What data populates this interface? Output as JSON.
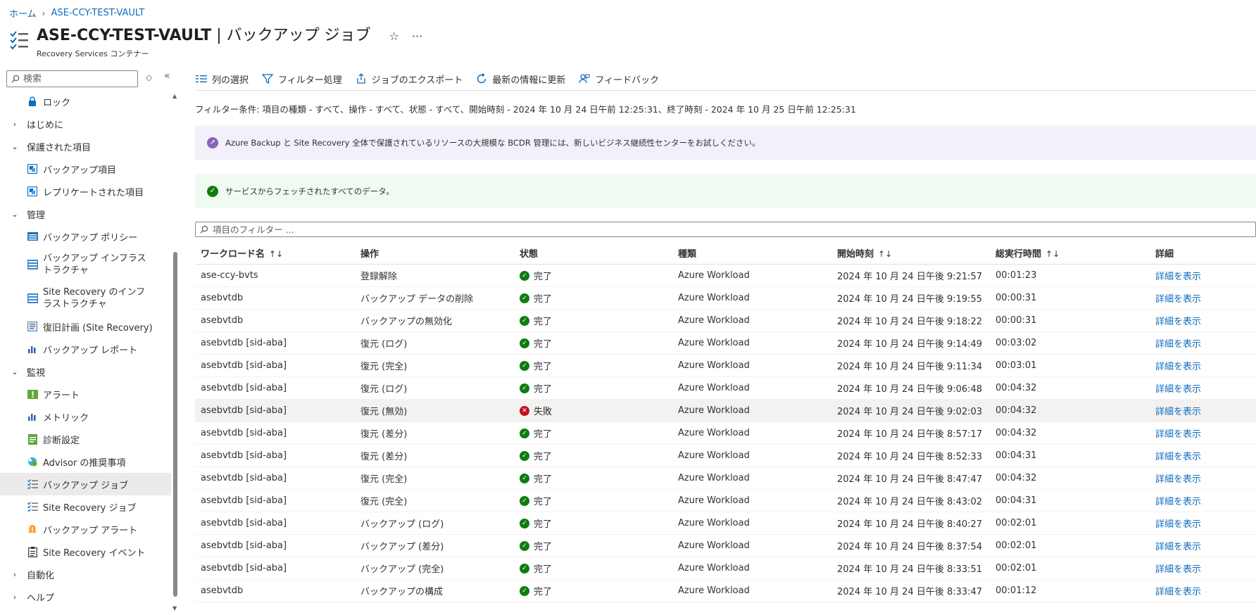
{
  "breadcrumb": {
    "home": "ホーム",
    "vault": "ASE-CCY-TEST-VAULT"
  },
  "header": {
    "title_main": "ASE-CCY-TEST-VAULT",
    "title_sep": " | ",
    "title_page": "バックアップ ジョブ",
    "subtitle": "Recovery Services コンテナー",
    "star_icon": "☆",
    "more_icon": "···"
  },
  "sidebar": {
    "search_placeholder": "検索",
    "items": [
      {
        "type": "child",
        "label": "ロック",
        "icon": "lock-icon"
      },
      {
        "type": "group",
        "label": "はじめに",
        "chev": "›"
      },
      {
        "type": "group",
        "label": "保護された項目",
        "chev": "⌄"
      },
      {
        "type": "child",
        "label": "バックアップ項目",
        "icon": "backup-items-icon"
      },
      {
        "type": "child",
        "label": "レプリケートされた項目",
        "icon": "replicated-items-icon"
      },
      {
        "type": "group",
        "label": "管理",
        "chev": "⌄"
      },
      {
        "type": "child",
        "label": "バックアップ ポリシー",
        "icon": "policy-icon"
      },
      {
        "type": "child",
        "label": "バックアップ インフラストラクチャ",
        "icon": "infrastructure-icon"
      },
      {
        "type": "child",
        "label": "Site Recovery のインフラストラクチャ",
        "icon": "site-recovery-infra-icon"
      },
      {
        "type": "child",
        "label": "復旧計画 (Site Recovery)",
        "icon": "recovery-plan-icon"
      },
      {
        "type": "child",
        "label": "バックアップ レポート",
        "icon": "reports-icon"
      },
      {
        "type": "group",
        "label": "監視",
        "chev": "⌄"
      },
      {
        "type": "child",
        "label": "アラート",
        "icon": "alert-icon"
      },
      {
        "type": "child",
        "label": "メトリック",
        "icon": "metrics-icon"
      },
      {
        "type": "child",
        "label": "診断設定",
        "icon": "diagnostic-icon"
      },
      {
        "type": "child",
        "label": "Advisor の推奨事項",
        "icon": "advisor-icon"
      },
      {
        "type": "child",
        "label": "バックアップ ジョブ",
        "icon": "jobs-icon"
      },
      {
        "type": "child",
        "label": "Site Recovery ジョブ",
        "icon": "site-recovery-jobs-icon"
      },
      {
        "type": "child",
        "label": "バックアップ アラート",
        "icon": "backup-alert-icon"
      },
      {
        "type": "child",
        "label": "Site Recovery イベント",
        "icon": "events-icon"
      },
      {
        "type": "group",
        "label": "自動化",
        "chev": "›"
      },
      {
        "type": "group",
        "label": "ヘルプ",
        "chev": "›"
      }
    ]
  },
  "toolbar": {
    "columns": "列の選択",
    "filter": "フィルター処理",
    "export": "ジョブのエクスポート",
    "refresh": "最新の情報に更新",
    "feedback": "フィードバック"
  },
  "filter_conditions": "フィルター条件: 項目の種類 - すべて、操作 - すべて、状態 - すべて、開始時刻 - 2024 年 10 月 24 日午前 12:25:31、終了時刻 - 2024 年 10 月 25 日午前 12:25:31",
  "banners": {
    "info": "Azure Backup と Site Recovery 全体で保護されているリソースの大規模な BCDR 管理には、新しいビジネス継続性センターをお試しください。",
    "success": "サービスからフェッチされたすべてのデータ。"
  },
  "grid_filter_placeholder": "項目のフィルター ...",
  "table": {
    "headers": {
      "workload": "ワークロード名",
      "operation": "操作",
      "status": "状態",
      "type": "種類",
      "start": "開始時刻",
      "duration": "総実行時間",
      "details": "詳細"
    },
    "sort_glyph": "↑↓",
    "rows": [
      {
        "workload": "ase-ccy-bvts",
        "operation": "登録解除",
        "status": "完了",
        "type": "Azure Workload",
        "start": "2024 年 10 月 24 日午後 9:21:57",
        "duration": "00:01:23",
        "details": "詳細を表示"
      },
      {
        "workload": "asebvtdb",
        "operation": "バックアップ データの削除",
        "status": "完了",
        "type": "Azure Workload",
        "start": "2024 年 10 月 24 日午後 9:19:55",
        "duration": "00:00:31",
        "details": "詳細を表示"
      },
      {
        "workload": "asebvtdb",
        "operation": "バックアップの無効化",
        "status": "完了",
        "type": "Azure Workload",
        "start": "2024 年 10 月 24 日午後 9:18:22",
        "duration": "00:00:31",
        "details": "詳細を表示"
      },
      {
        "workload": "asebvtdb [sid-aba]",
        "operation": "復元 (ログ)",
        "status": "完了",
        "type": "Azure Workload",
        "start": "2024 年 10 月 24 日午後 9:14:49",
        "duration": "00:03:02",
        "details": "詳細を表示"
      },
      {
        "workload": "asebvtdb [sid-aba]",
        "operation": "復元 (完全)",
        "status": "完了",
        "type": "Azure Workload",
        "start": "2024 年 10 月 24 日午後 9:11:34",
        "duration": "00:03:01",
        "details": "詳細を表示"
      },
      {
        "workload": "asebvtdb [sid-aba]",
        "operation": "復元 (ログ)",
        "status": "完了",
        "type": "Azure Workload",
        "start": "2024 年 10 月 24 日午後 9:06:48",
        "duration": "00:04:32",
        "details": "詳細を表示"
      },
      {
        "workload": "asebvtdb [sid-aba]",
        "operation": "復元 (無効)",
        "status": "失敗",
        "type": "Azure Workload",
        "start": "2024 年 10 月 24 日午後 9:02:03",
        "duration": "00:04:32",
        "details": "詳細を表示"
      },
      {
        "workload": "asebvtdb [sid-aba]",
        "operation": "復元 (差分)",
        "status": "完了",
        "type": "Azure Workload",
        "start": "2024 年 10 月 24 日午後 8:57:17",
        "duration": "00:04:32",
        "details": "詳細を表示"
      },
      {
        "workload": "asebvtdb [sid-aba]",
        "operation": "復元 (差分)",
        "status": "完了",
        "type": "Azure Workload",
        "start": "2024 年 10 月 24 日午後 8:52:33",
        "duration": "00:04:31",
        "details": "詳細を表示"
      },
      {
        "workload": "asebvtdb [sid-aba]",
        "operation": "復元 (完全)",
        "status": "完了",
        "type": "Azure Workload",
        "start": "2024 年 10 月 24 日午後 8:47:47",
        "duration": "00:04:32",
        "details": "詳細を表示"
      },
      {
        "workload": "asebvtdb [sid-aba]",
        "operation": "復元 (完全)",
        "status": "完了",
        "type": "Azure Workload",
        "start": "2024 年 10 月 24 日午後 8:43:02",
        "duration": "00:04:31",
        "details": "詳細を表示"
      },
      {
        "workload": "asebvtdb [sid-aba]",
        "operation": "バックアップ (ログ)",
        "status": "完了",
        "type": "Azure Workload",
        "start": "2024 年 10 月 24 日午後 8:40:27",
        "duration": "00:02:01",
        "details": "詳細を表示"
      },
      {
        "workload": "asebvtdb [sid-aba]",
        "operation": "バックアップ (差分)",
        "status": "完了",
        "type": "Azure Workload",
        "start": "2024 年 10 月 24 日午後 8:37:54",
        "duration": "00:02:01",
        "details": "詳細を表示"
      },
      {
        "workload": "asebvtdb [sid-aba]",
        "operation": "バックアップ (完全)",
        "status": "完了",
        "type": "Azure Workload",
        "start": "2024 年 10 月 24 日午後 8:33:51",
        "duration": "00:02:01",
        "details": "詳細を表示"
      },
      {
        "workload": "asebvtdb",
        "operation": "バックアップの構成",
        "status": "完了",
        "type": "Azure Workload",
        "start": "2024 年 10 月 24 日午後 8:33:47",
        "duration": "00:01:12",
        "details": "詳細を表示"
      }
    ]
  },
  "colors": {
    "link": "#0f6cbd",
    "success": "#107c10",
    "fail": "#c50f1f",
    "info_bg": "#f4f0f9",
    "success_bg": "#f1faf1",
    "accent_purple": "#8764b8"
  }
}
